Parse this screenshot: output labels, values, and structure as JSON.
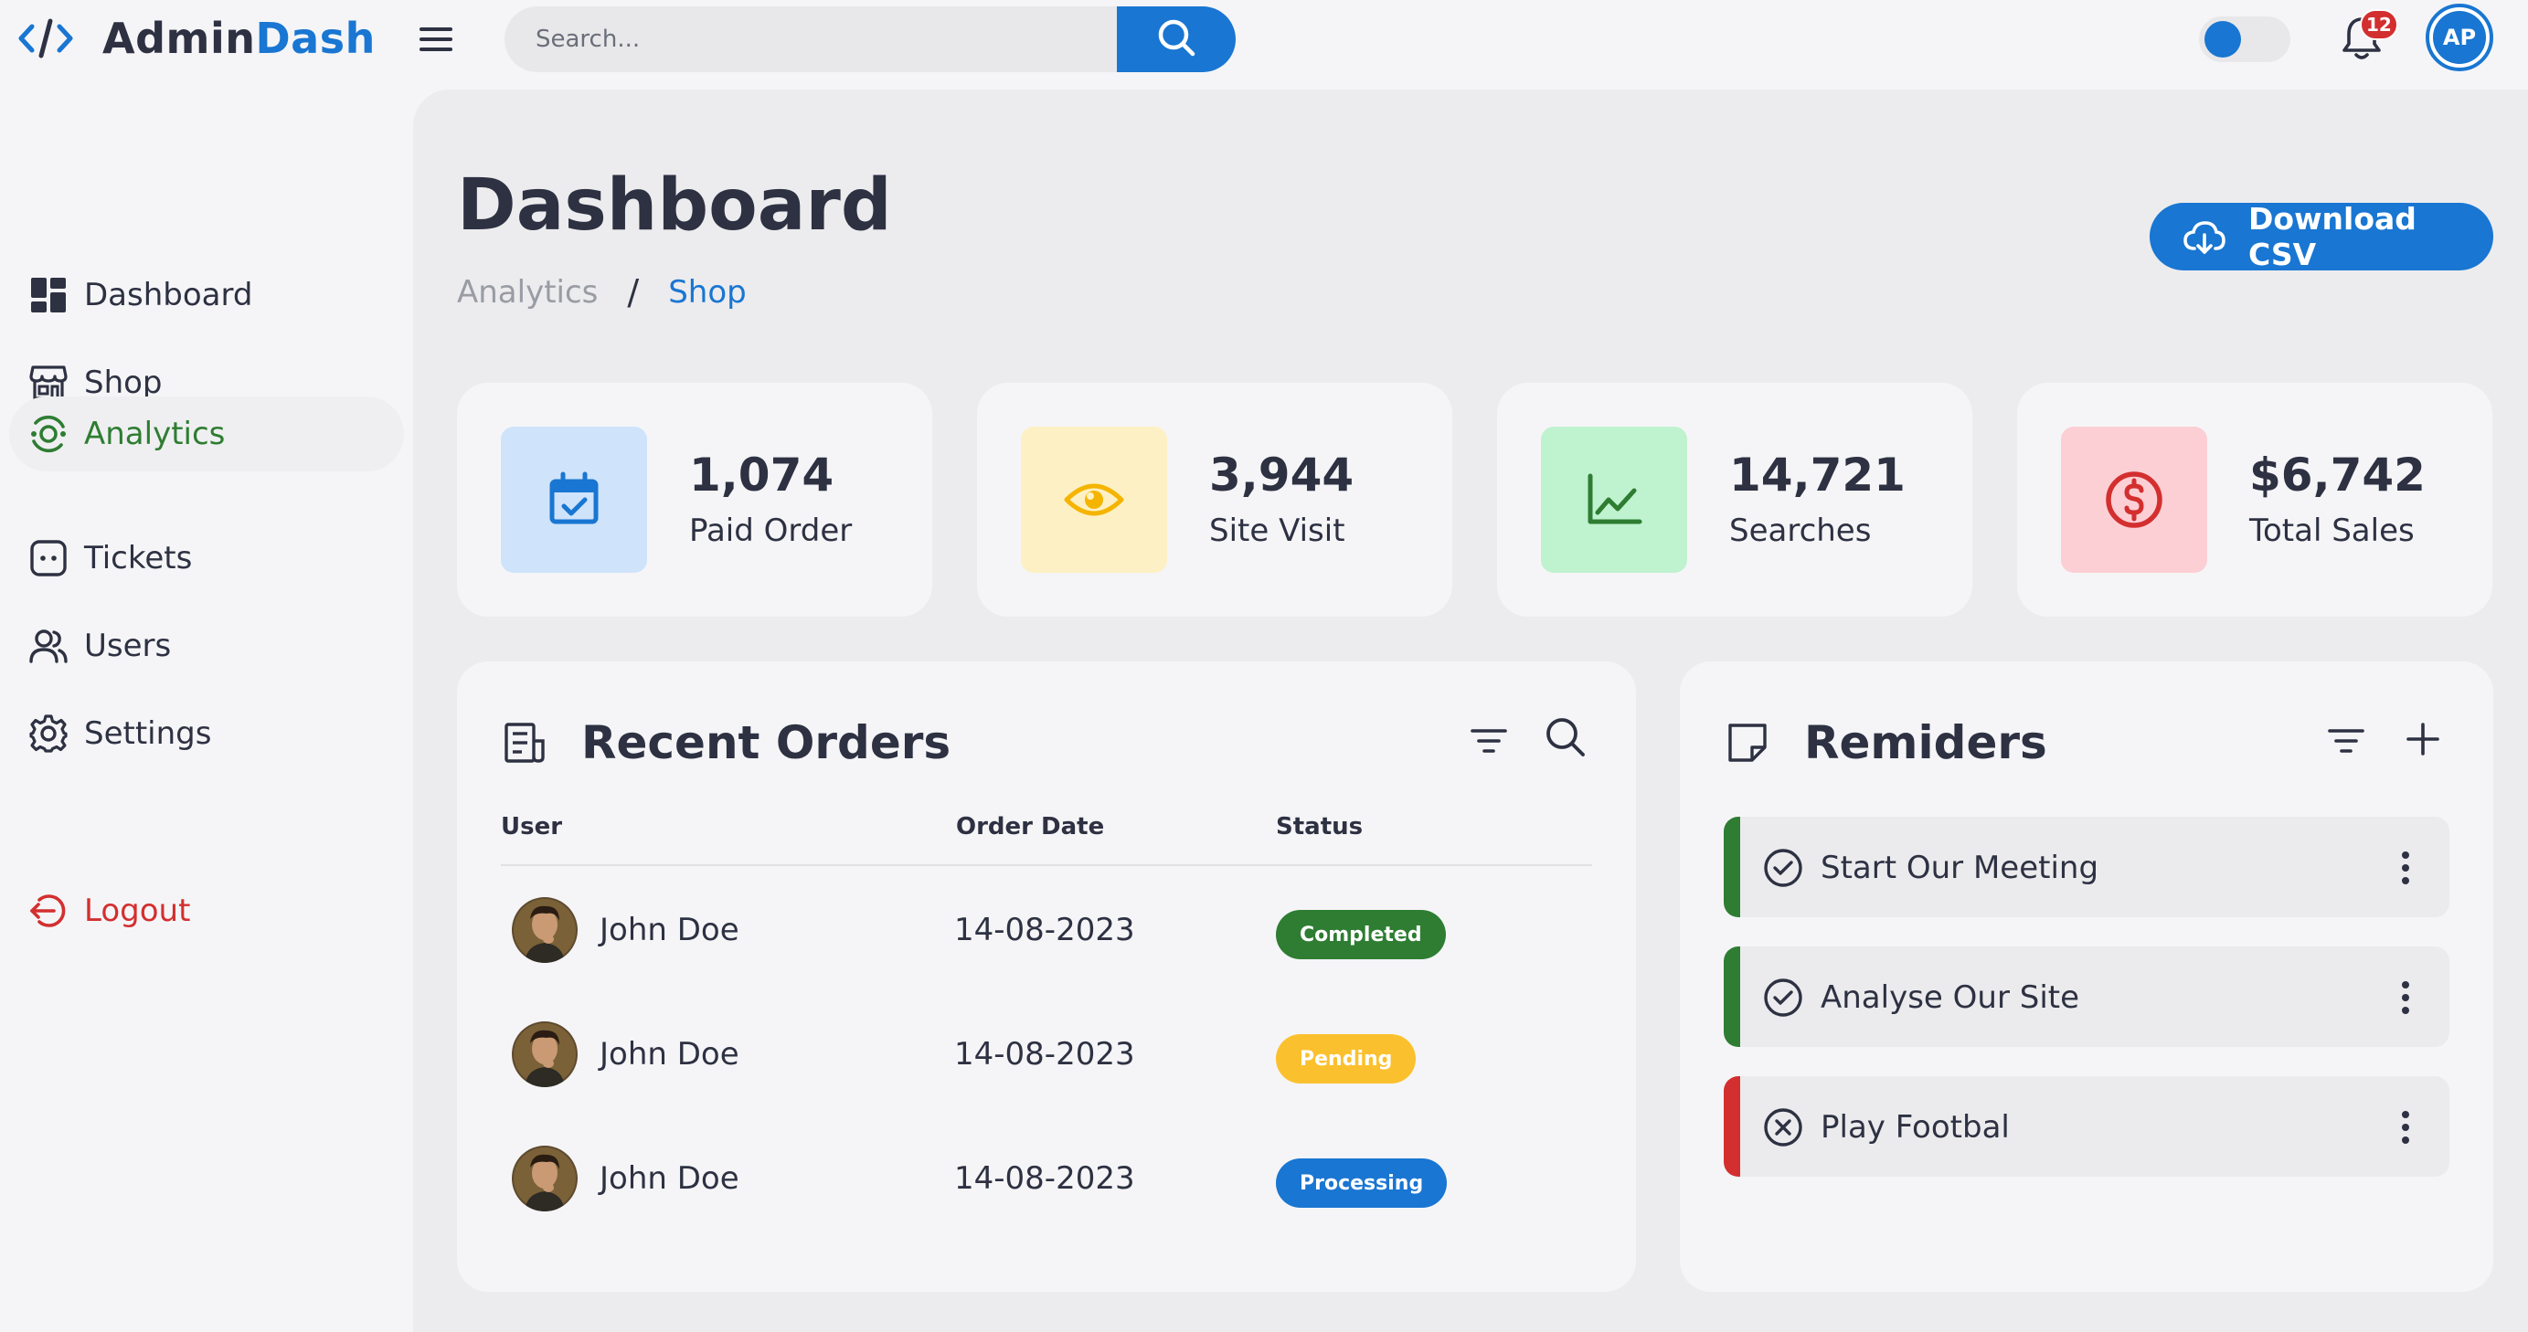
{
  "brand": {
    "name_part1": "Admin",
    "name_part2": "Dash",
    "logo_icon": "code-icon"
  },
  "topbar": {
    "menu_icon": "menu-icon",
    "search": {
      "placeholder": "Search...",
      "value": "",
      "button_icon": "search-icon"
    },
    "theme_toggle_on": true,
    "notifications": {
      "icon": "bell-icon",
      "count": "12"
    },
    "avatar_initials": "AP"
  },
  "sidebar": {
    "items": [
      {
        "label": "Dashboard",
        "icon": "dashboard-grid-icon",
        "active": false
      },
      {
        "label": "Shop",
        "icon": "store-icon",
        "active": false
      },
      {
        "label": "Analytics",
        "icon": "analytics-icon",
        "active": true
      },
      {
        "label": "Tickets",
        "icon": "ticket-icon",
        "active": false
      },
      {
        "label": "Users",
        "icon": "users-icon",
        "active": false
      },
      {
        "label": "Settings",
        "icon": "gear-icon",
        "active": false
      }
    ],
    "logout": {
      "label": "Logout",
      "icon": "logout-icon"
    }
  },
  "header": {
    "title": "Dashboard",
    "breadcrumb": [
      "Analytics",
      "Shop"
    ],
    "breadcrumb_separator": "/",
    "download_button": {
      "label": "Download CSV",
      "icon": "cloud-download-icon"
    }
  },
  "stats": [
    {
      "value": "1,074",
      "label": "Paid Order",
      "icon": "calendar-check-icon",
      "color": "#1976d2",
      "bg": "#cfe3fb"
    },
    {
      "value": "3,944",
      "label": "Site Visit",
      "icon": "eye-icon",
      "color": "#f4b400",
      "bg": "#fdf0c4"
    },
    {
      "value": "14,721",
      "label": "Searches",
      "icon": "line-chart-icon",
      "color": "#2e7d32",
      "bg": "#bff2cf"
    },
    {
      "value": "$6,742",
      "label": "Total Sales",
      "icon": "dollar-circle-icon",
      "color": "#d32f2f",
      "bg": "#fccfd5"
    }
  ],
  "orders": {
    "title": "Recent Orders",
    "icon": "receipt-icon",
    "tools": [
      "filter-icon",
      "search-icon"
    ],
    "columns": [
      "User",
      "Order Date",
      "Status"
    ],
    "rows": [
      {
        "user": "John Doe",
        "date": "14-08-2023",
        "status": "Completed",
        "status_bg": "#2e7d32",
        "status_fg": "#ffffff"
      },
      {
        "user": "John Doe",
        "date": "14-08-2023",
        "status": "Pending",
        "status_bg": "#fbc02d",
        "status_fg": "#ffffff"
      },
      {
        "user": "John Doe",
        "date": "14-08-2023",
        "status": "Processing",
        "status_bg": "#1976d2",
        "status_fg": "#ffffff"
      }
    ]
  },
  "reminders": {
    "title": "Remiders",
    "icon": "note-icon",
    "tools": [
      "filter-icon",
      "plus-icon"
    ],
    "items": [
      {
        "text": "Start Our Meeting",
        "state": "done",
        "icon": "check-circle-icon",
        "color": "#2e7d32"
      },
      {
        "text": "Analyse Our Site",
        "state": "done",
        "icon": "check-circle-icon",
        "color": "#2e7d32"
      },
      {
        "text": "Play Footbal",
        "state": "cancelled",
        "icon": "x-circle-icon",
        "color": "#d32f2f"
      }
    ]
  }
}
